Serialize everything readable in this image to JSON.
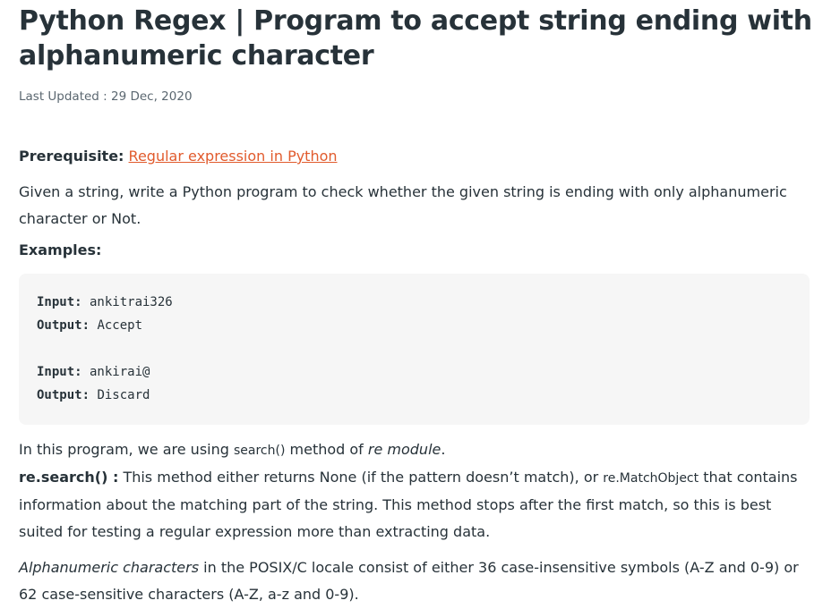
{
  "article": {
    "title": "Python Regex | Program to accept string ending with alphanumeric character",
    "last_updated": "Last Updated : 29 Dec, 2020",
    "prerequisite_label": "Prerequisite:",
    "prerequisite_link": "Regular expression in Python",
    "intro": "Given a string, write a Python program to check whether the given string is ending with only alphanumeric character or Not.",
    "examples_heading": "Examples:",
    "examples": [
      {
        "input_label": "Input:",
        "input_value": " ankitrai326",
        "output_label": "Output:",
        "output_value": " Accept"
      },
      {
        "input_label": "Input:",
        "input_value": " ankirai@",
        "output_label": "Output:",
        "output_value": " Discard"
      }
    ],
    "program_text_1": "In this program, we are using ",
    "program_search": "search()",
    "program_text_2": " method of ",
    "program_module": "re module",
    "program_text_3": ".",
    "re_search_label": "re.search() :",
    "re_search_text_1": " This method either returns None (if the pattern doesn’t match), or ",
    "re_match_object": "re.MatchObject",
    "re_search_text_2": " that contains information about the matching part of the string. This method stops after the first match, so this is best suited for testing a regular expression more than extracting data.",
    "alnum_em": "Alphanumeric characters",
    "alnum_text": " in the POSIX/C locale consist of either 36 case-insensitive symbols (A-Z and 0-9) or 62 case-sensitive characters (A-Z, a-z and 0-9)."
  },
  "colors": {
    "link": "#e15b2d",
    "text": "#273239",
    "code_bg": "#f6f6f6"
  }
}
